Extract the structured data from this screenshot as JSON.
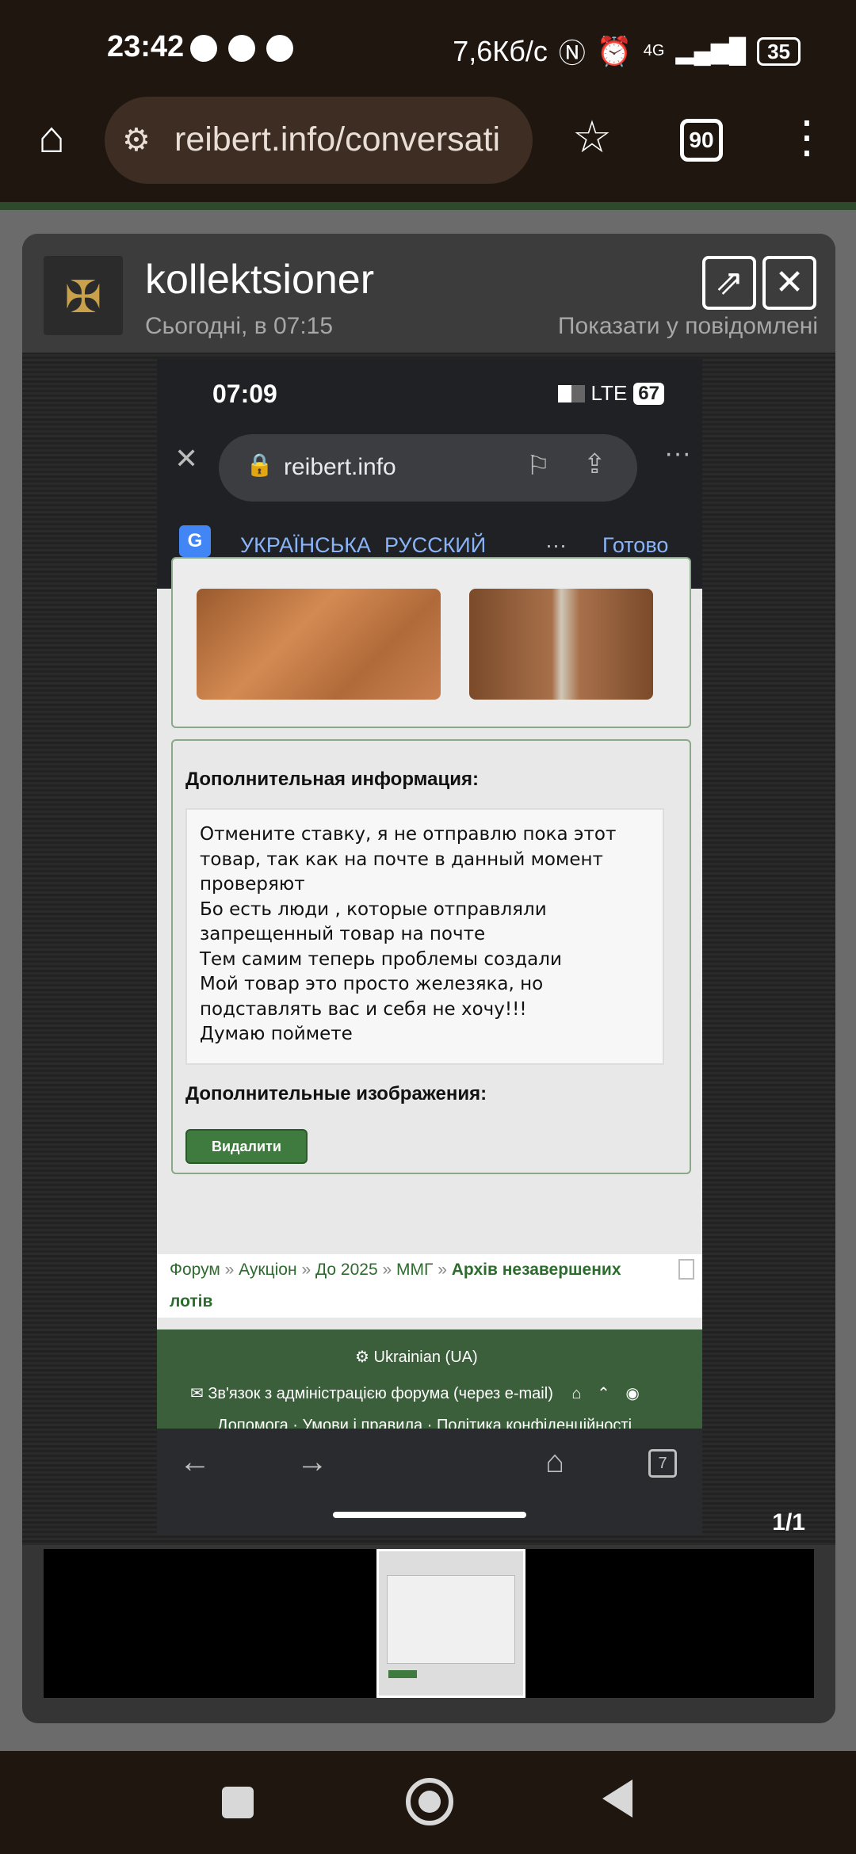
{
  "status_bar": {
    "time": "23:42",
    "speed": "7,6Кб/с",
    "network": "4G",
    "battery": "35"
  },
  "browser": {
    "url": "reibert.info/conversati",
    "tab_count": "90"
  },
  "lightbox": {
    "author": "kollektsioner",
    "date": "Сьогодні, в 07:15",
    "show_in_post": "Показати у повідомлені",
    "counter": "1/1"
  },
  "inner": {
    "status_time": "07:09",
    "network": "LTE",
    "battery": "67",
    "url": "reibert.info",
    "translate": {
      "lang1": "УКРАЇНСЬКА",
      "lang2": "РУССКИЙ",
      "more": "···",
      "done": "Готово"
    },
    "info_title": "Дополнительная информация:",
    "info_lines": [
      "Отмените ставку, я не отправлю пока этот",
      "товар, так как на почте в данный момент",
      "проверяют",
      "Бо есть люди , которые отправляли",
      "запрещенный товар на почте",
      "Тем самим теперь проблемы создали",
      "Мой товар это просто железяка, но",
      "подставлять вас и себя не хочу!!!",
      "Думаю поймете"
    ],
    "images_title": "Дополнительные изображения:",
    "delete_label": "Видалити",
    "breadcrumb": {
      "items": [
        "Форум",
        "Аукціон",
        "До 2025",
        "ММГ"
      ],
      "current_line1": "Архів незавершених",
      "current_line2": "лотів"
    },
    "footer": {
      "language": "Ukrainian (UA)",
      "contact": "Зв'язок з адміністрацією форума (через e-mail)",
      "links": "Допомога · Умови і правила · Політика конфіденційності"
    },
    "tab_count": "7"
  }
}
